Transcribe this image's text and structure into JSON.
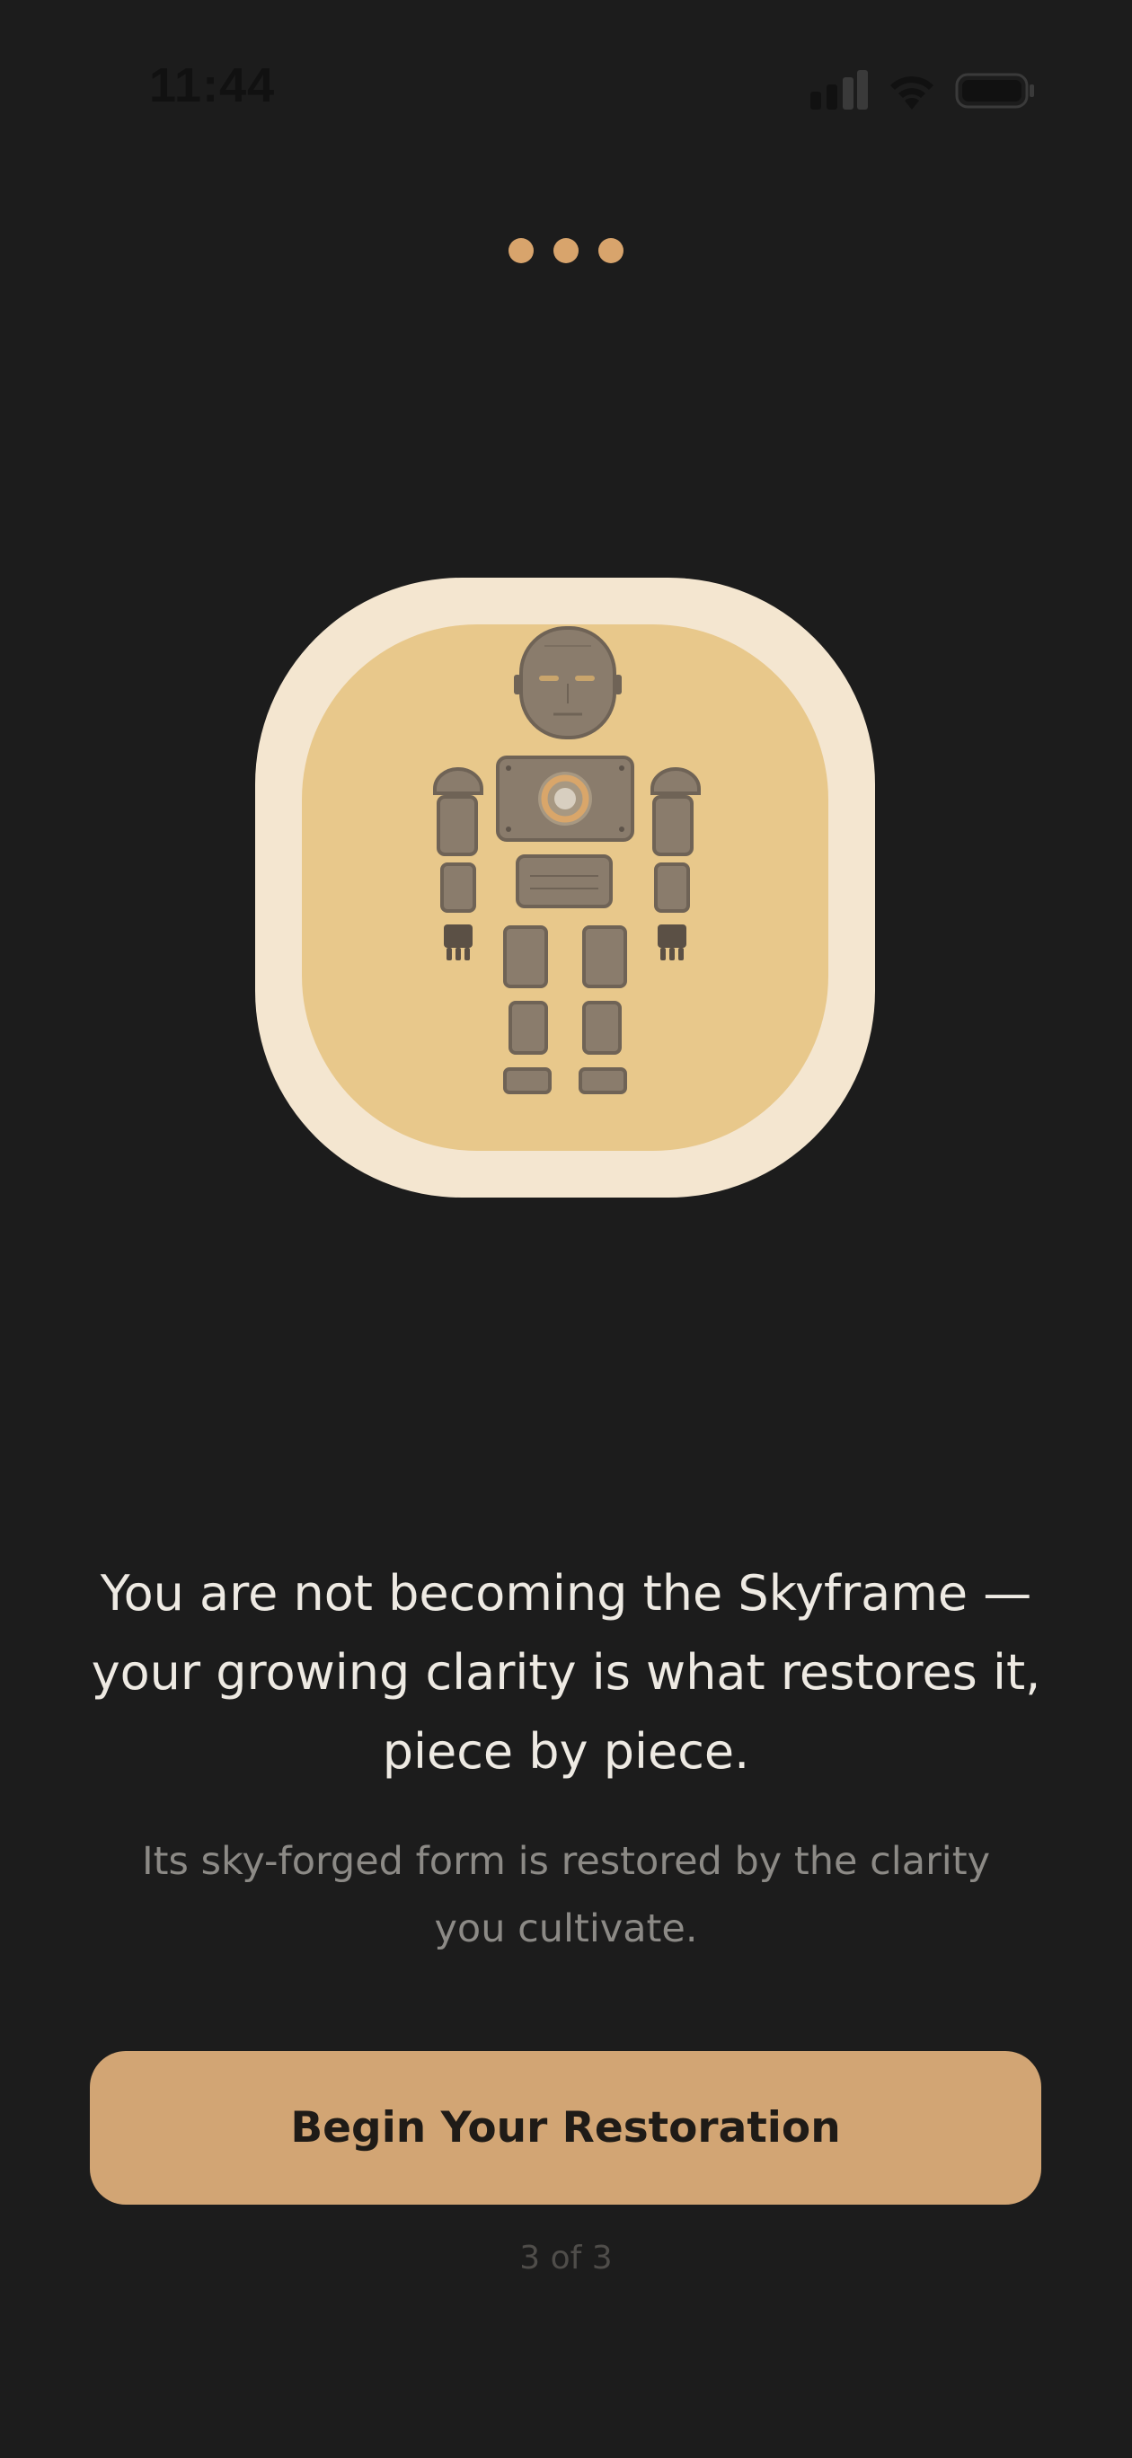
{
  "status_bar": {
    "time": "11:44",
    "icons": [
      "signal-icon",
      "wifi-icon",
      "battery-icon"
    ]
  },
  "pager": {
    "total_pages": 3,
    "current_page": 3
  },
  "illustration": {
    "icon": "skyframe-robot-parts-icon",
    "colors": {
      "outer": "#f4e6d0",
      "inner": "#e8c88b",
      "parts": "#8a7c6c"
    }
  },
  "content": {
    "headline": "You are not becoming the Skyframe —\nyour growing clarity is what restores it,\npiece by piece.",
    "subheadline": "Its sky-forged form is restored by the clarity\nyou cultivate."
  },
  "cta": {
    "label": "Begin Your Restoration"
  },
  "step_indicator": "3 of 3",
  "colors": {
    "background": "#1c1c1c",
    "accent": "#d2a574",
    "dot": "#d8a46c"
  }
}
